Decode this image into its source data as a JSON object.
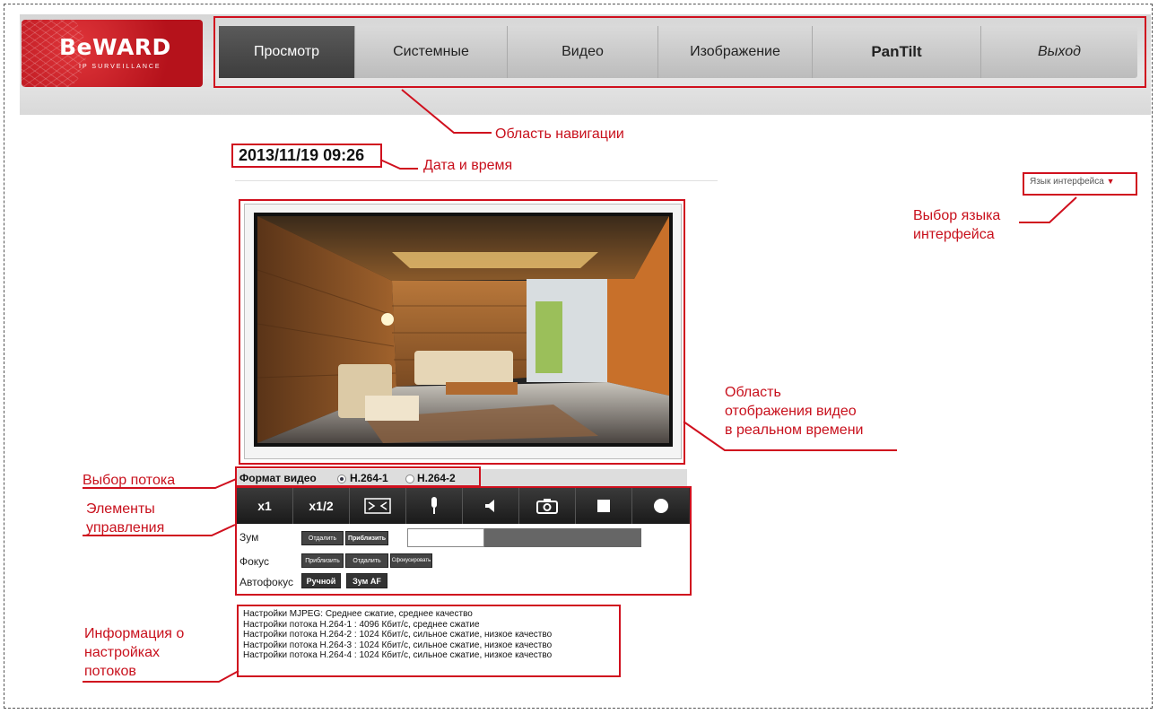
{
  "logo": {
    "brand": "BeWARD",
    "tagline": "IP SURVEILLANCE"
  },
  "nav": {
    "items": [
      {
        "label": "Просмотр",
        "active": true
      },
      {
        "label": "Системные"
      },
      {
        "label": "Видео"
      },
      {
        "label": "Изображение"
      },
      {
        "label": "PanTilt"
      },
      {
        "label": "Выход"
      }
    ]
  },
  "datetime": "2013/11/19 09:26",
  "language": {
    "label": "Язык интерфейса",
    "arrow": "▼"
  },
  "stream": {
    "label": "Формат видео",
    "options": [
      {
        "label": "H.264-1",
        "selected": true
      },
      {
        "label": "H.264-2",
        "selected": false
      }
    ]
  },
  "toolbar": {
    "buttons": [
      {
        "label": "x1",
        "icon": ""
      },
      {
        "label": "x1/2",
        "icon": ""
      },
      {
        "label": "",
        "icon": "fit-screen-icon"
      },
      {
        "label": "",
        "icon": "microphone-icon"
      },
      {
        "label": "",
        "icon": "speaker-icon"
      },
      {
        "label": "",
        "icon": "camera-snapshot-icon"
      },
      {
        "label": "",
        "icon": "stop-icon"
      },
      {
        "label": "",
        "icon": "record-icon"
      }
    ]
  },
  "controls": {
    "zoom": {
      "label": "Зум",
      "buttons": [
        "Отдалить",
        "Приблизить"
      ],
      "level": 0.33
    },
    "focus": {
      "label": "Фокус",
      "buttons": [
        "Приблизить",
        "Отдалить",
        "Сфокусировать"
      ]
    },
    "autofocus": {
      "label": "Автофокус",
      "buttons": [
        "Ручной",
        "Зум AF"
      ]
    }
  },
  "info_lines": [
    "Настройки MJPEG: Среднее сжатие, среднее качество",
    "Настройки потока H.264-1 : 4096 Кбит/с, среднее сжатие",
    "Настройки потока H.264-2 : 1024 Кбит/с, сильное сжатие, низкое качество",
    "Настройки потока H.264-3 : 1024 Кбит/с, сильное сжатие, низкое качество",
    "Настройки потока H.264-4 : 1024 Кбит/с, сильное сжатие, низкое качество"
  ],
  "annotations": {
    "navigation": "Область навигации",
    "datetime": "Дата и время",
    "language_1": "Выбор языка",
    "language_2": "интерфейса",
    "video_1": "Область",
    "video_2": "отображения видео",
    "video_3": "в реальном времени",
    "stream": "Выбор потока",
    "controls_1": "Элементы",
    "controls_2": "управления",
    "info_1": "Информация о",
    "info_2": "настройках",
    "info_3": "потоков"
  },
  "colors": {
    "accent": "#d0101e",
    "nav_active": "#4a4a4a"
  }
}
